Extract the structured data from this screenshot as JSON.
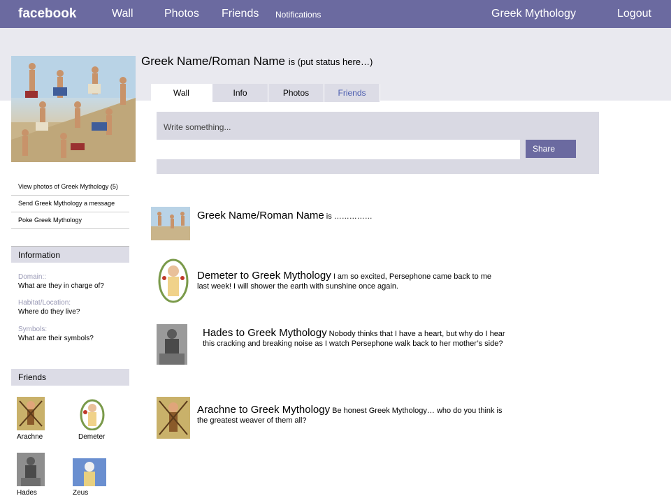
{
  "topbar": {
    "logo": "facebook",
    "nav": [
      "Wall",
      "Photos",
      "Friends",
      "Notifications"
    ],
    "user": "Greek Mythology",
    "logout": "Logout"
  },
  "profile": {
    "name": "Greek Name/Roman Name",
    "status": "is (put status here…)"
  },
  "tabs": [
    "Wall",
    "Info",
    "Photos",
    "Friends"
  ],
  "composer": {
    "prompt": "Write something...",
    "share": "Share"
  },
  "side_links": [
    "View photos of Greek Mythology (5)",
    "Send Greek Mythology a message",
    "Poke Greek Mythology"
  ],
  "information": {
    "heading": "Information",
    "items": [
      {
        "key": "Domain::",
        "value": "What are they in charge of?"
      },
      {
        "key": "Habitat/Location:",
        "value": "Where do they live?"
      },
      {
        "key": "Symbols:",
        "value": "What are their symbols?"
      }
    ]
  },
  "friends": {
    "heading": "Friends",
    "list": [
      "Arachne",
      "Demeter",
      "Hades",
      "Zeus"
    ]
  },
  "posts": [
    {
      "author": "Greek Name/Roman Name",
      "message": "is ……………"
    },
    {
      "author": "Demeter to Greek Mythology",
      "message": "I am so excited, Persephone came back to me last week! I will shower the earth with sunshine once again."
    },
    {
      "author": "Hades to Greek Mythology",
      "message": "Nobody thinks that I have a heart, but why do I hear this cracking and breaking noise as I watch Persephone walk back to her mother’s side?"
    },
    {
      "author": "Arachne to Greek Mythology",
      "message": "Be honest Greek Mythology… who do you think is the greatest weaver of them all?"
    }
  ]
}
